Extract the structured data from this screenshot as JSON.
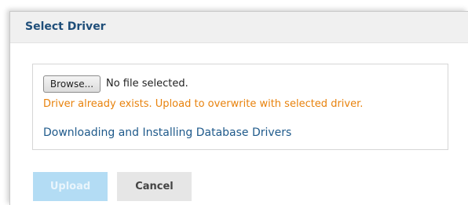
{
  "dialog": {
    "title": "Select Driver",
    "file_input": {
      "button_label": "Browse...",
      "status": "No file selected."
    },
    "warning": "Driver already exists. Upload to overwrite with selected driver.",
    "help_link": "Downloading and Installing Database Drivers",
    "buttons": {
      "upload": "Upload",
      "cancel": "Cancel"
    }
  },
  "colors": {
    "title": "#1f4e79",
    "warning": "#e8820c",
    "link": "#1f5a8b",
    "upload_disabled": "#b3dcf4",
    "cancel_bg": "#e6e6e6"
  }
}
